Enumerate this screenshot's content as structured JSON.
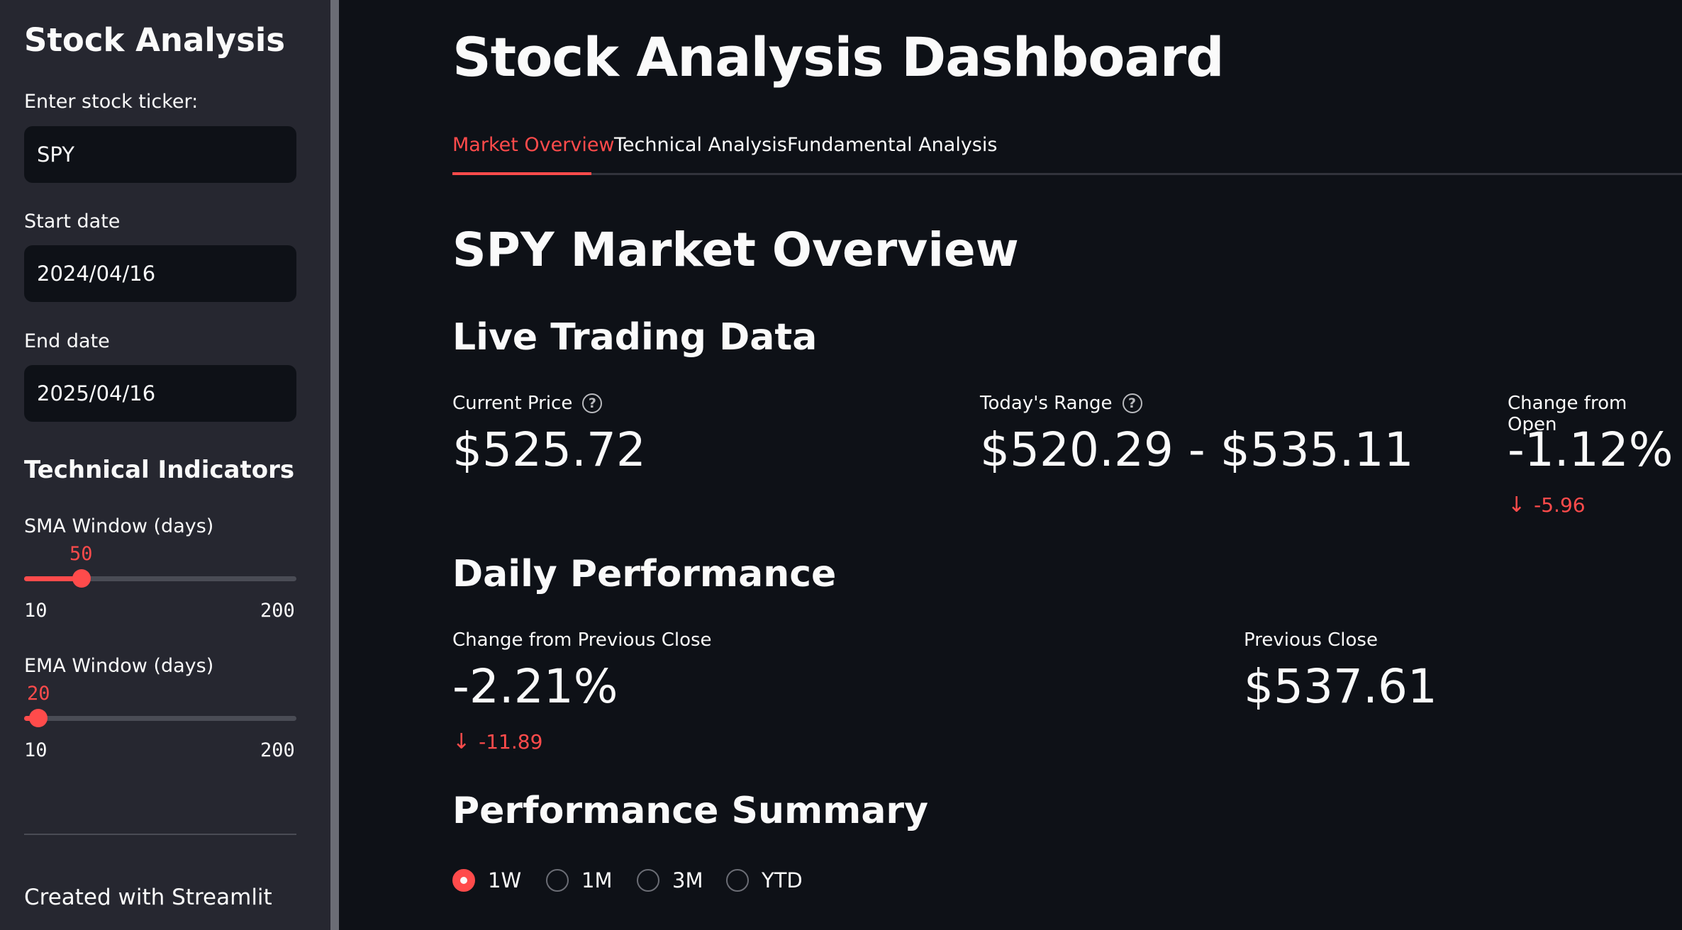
{
  "sidebar": {
    "title": "Stock Analysis",
    "ticker_label": "Enter stock ticker:",
    "ticker_value": "SPY",
    "start_label": "Start date",
    "start_value": "2024/04/16",
    "end_label": "End date",
    "end_value": "2025/04/16",
    "indicators_title": "Technical Indicators",
    "sma": {
      "label": "SMA Window (days)",
      "value": "50",
      "min": "10",
      "max": "200"
    },
    "ema": {
      "label": "EMA Window (days)",
      "value": "20",
      "min": "10",
      "max": "200"
    },
    "footer": "Created with Streamlit"
  },
  "main": {
    "title": "Stock Analysis Dashboard",
    "tabs": [
      {
        "label": "Market Overview"
      },
      {
        "label": "Technical Analysis"
      },
      {
        "label": "Fundamental Analysis"
      }
    ],
    "section_title": "SPY Market Overview",
    "live": {
      "title": "Live Trading Data",
      "current_price": {
        "label": "Current Price",
        "value": "$525.72"
      },
      "todays_range": {
        "label": "Today's Range",
        "value": "$520.29 - $535.11"
      },
      "change_from_open": {
        "label": "Change from Open",
        "value": "-1.12%",
        "delta": "-5.96"
      }
    },
    "daily": {
      "title": "Daily Performance",
      "change_prev_close": {
        "label": "Change from Previous Close",
        "value": "-2.21%",
        "delta": "-11.89"
      },
      "previous_close": {
        "label": "Previous Close",
        "value": "$537.61"
      }
    },
    "summary": {
      "title": "Performance Summary",
      "options": [
        "1W",
        "1M",
        "3M",
        "YTD"
      ],
      "selected": "1W"
    }
  },
  "colors": {
    "accent": "#ff4b4b",
    "background": "#0e1117",
    "sidebar": "#262730"
  },
  "icons": {
    "help": "question-circle-icon",
    "delta_down": "arrow-down-icon"
  }
}
